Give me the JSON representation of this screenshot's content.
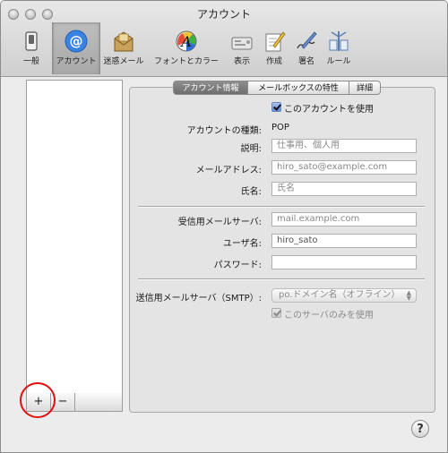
{
  "window": {
    "title": "アカウント"
  },
  "toolbar": {
    "items": [
      {
        "label": "一般",
        "icon": "switch-icon"
      },
      {
        "label": "アカウント",
        "icon": "at-sign-icon"
      },
      {
        "label": "迷惑メール",
        "icon": "junk-mail-icon"
      },
      {
        "label": "フォントとカラー",
        "icon": "fonts-colors-icon"
      },
      {
        "label": "表示",
        "icon": "viewing-icon"
      },
      {
        "label": "作成",
        "icon": "composing-icon"
      },
      {
        "label": "署名",
        "icon": "signature-icon"
      },
      {
        "label": "ルール",
        "icon": "rules-icon"
      }
    ],
    "selected": "アカウント"
  },
  "account_list": {
    "add_label": "+",
    "remove_label": "−"
  },
  "tabs": [
    {
      "label": "アカウント情報",
      "active": true
    },
    {
      "label": "メールボックスの特性",
      "active": false
    },
    {
      "label": "詳細",
      "active": false
    }
  ],
  "form": {
    "enable_label": "このアカウントを使用",
    "type_label": "アカウントの種類:",
    "type_value": "POP",
    "description_label": "説明:",
    "description_placeholder": "仕事用、個人用",
    "email_label": "メールアドレス:",
    "email_placeholder": "hiro_sato@example.com",
    "name_label": "氏名:",
    "name_placeholder": "氏名",
    "incoming_label": "受信用メールサーバ:",
    "incoming_placeholder": "mail.example.com",
    "username_label": "ユーザ名:",
    "username_value": "hiro_sato",
    "password_label": "パスワード:",
    "password_value": "",
    "smtp_label": "送信用メールサーバ（SMTP）:",
    "smtp_selected": "po.ドメイン名（オフライン）",
    "smtp_only_label": "このサーバのみを使用"
  },
  "help": {
    "label": "?"
  },
  "colors": {
    "highlight_circle": "#e01010",
    "selected_toolbar": "#b3b3b3",
    "checkbox_blue": "#5d8ad8"
  }
}
